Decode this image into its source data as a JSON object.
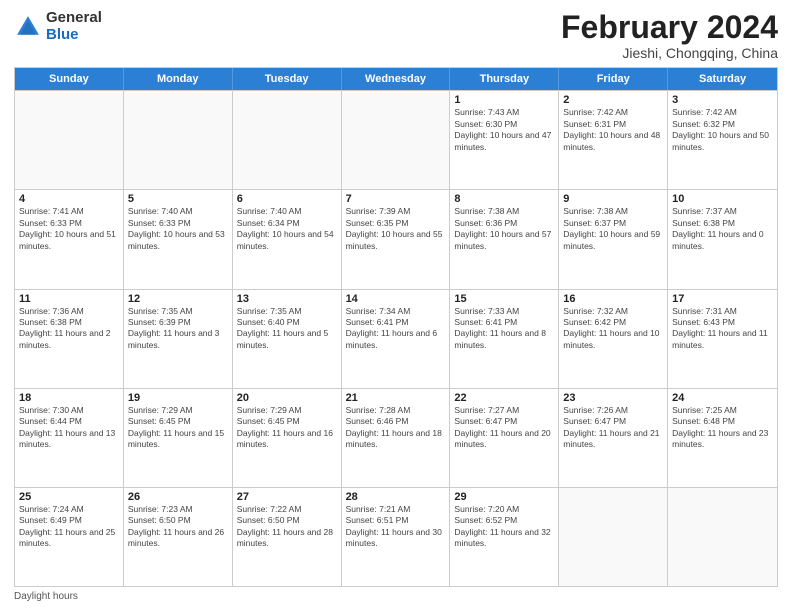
{
  "logo": {
    "general": "General",
    "blue": "Blue"
  },
  "title": {
    "month_year": "February 2024",
    "location": "Jieshi, Chongqing, China"
  },
  "header_days": [
    "Sunday",
    "Monday",
    "Tuesday",
    "Wednesday",
    "Thursday",
    "Friday",
    "Saturday"
  ],
  "weeks": [
    [
      {
        "day": "",
        "info": ""
      },
      {
        "day": "",
        "info": ""
      },
      {
        "day": "",
        "info": ""
      },
      {
        "day": "",
        "info": ""
      },
      {
        "day": "1",
        "info": "Sunrise: 7:43 AM\nSunset: 6:30 PM\nDaylight: 10 hours and 47 minutes."
      },
      {
        "day": "2",
        "info": "Sunrise: 7:42 AM\nSunset: 6:31 PM\nDaylight: 10 hours and 48 minutes."
      },
      {
        "day": "3",
        "info": "Sunrise: 7:42 AM\nSunset: 6:32 PM\nDaylight: 10 hours and 50 minutes."
      }
    ],
    [
      {
        "day": "4",
        "info": "Sunrise: 7:41 AM\nSunset: 6:33 PM\nDaylight: 10 hours and 51 minutes."
      },
      {
        "day": "5",
        "info": "Sunrise: 7:40 AM\nSunset: 6:33 PM\nDaylight: 10 hours and 53 minutes."
      },
      {
        "day": "6",
        "info": "Sunrise: 7:40 AM\nSunset: 6:34 PM\nDaylight: 10 hours and 54 minutes."
      },
      {
        "day": "7",
        "info": "Sunrise: 7:39 AM\nSunset: 6:35 PM\nDaylight: 10 hours and 55 minutes."
      },
      {
        "day": "8",
        "info": "Sunrise: 7:38 AM\nSunset: 6:36 PM\nDaylight: 10 hours and 57 minutes."
      },
      {
        "day": "9",
        "info": "Sunrise: 7:38 AM\nSunset: 6:37 PM\nDaylight: 10 hours and 59 minutes."
      },
      {
        "day": "10",
        "info": "Sunrise: 7:37 AM\nSunset: 6:38 PM\nDaylight: 11 hours and 0 minutes."
      }
    ],
    [
      {
        "day": "11",
        "info": "Sunrise: 7:36 AM\nSunset: 6:38 PM\nDaylight: 11 hours and 2 minutes."
      },
      {
        "day": "12",
        "info": "Sunrise: 7:35 AM\nSunset: 6:39 PM\nDaylight: 11 hours and 3 minutes."
      },
      {
        "day": "13",
        "info": "Sunrise: 7:35 AM\nSunset: 6:40 PM\nDaylight: 11 hours and 5 minutes."
      },
      {
        "day": "14",
        "info": "Sunrise: 7:34 AM\nSunset: 6:41 PM\nDaylight: 11 hours and 6 minutes."
      },
      {
        "day": "15",
        "info": "Sunrise: 7:33 AM\nSunset: 6:41 PM\nDaylight: 11 hours and 8 minutes."
      },
      {
        "day": "16",
        "info": "Sunrise: 7:32 AM\nSunset: 6:42 PM\nDaylight: 11 hours and 10 minutes."
      },
      {
        "day": "17",
        "info": "Sunrise: 7:31 AM\nSunset: 6:43 PM\nDaylight: 11 hours and 11 minutes."
      }
    ],
    [
      {
        "day": "18",
        "info": "Sunrise: 7:30 AM\nSunset: 6:44 PM\nDaylight: 11 hours and 13 minutes."
      },
      {
        "day": "19",
        "info": "Sunrise: 7:29 AM\nSunset: 6:45 PM\nDaylight: 11 hours and 15 minutes."
      },
      {
        "day": "20",
        "info": "Sunrise: 7:29 AM\nSunset: 6:45 PM\nDaylight: 11 hours and 16 minutes."
      },
      {
        "day": "21",
        "info": "Sunrise: 7:28 AM\nSunset: 6:46 PM\nDaylight: 11 hours and 18 minutes."
      },
      {
        "day": "22",
        "info": "Sunrise: 7:27 AM\nSunset: 6:47 PM\nDaylight: 11 hours and 20 minutes."
      },
      {
        "day": "23",
        "info": "Sunrise: 7:26 AM\nSunset: 6:47 PM\nDaylight: 11 hours and 21 minutes."
      },
      {
        "day": "24",
        "info": "Sunrise: 7:25 AM\nSunset: 6:48 PM\nDaylight: 11 hours and 23 minutes."
      }
    ],
    [
      {
        "day": "25",
        "info": "Sunrise: 7:24 AM\nSunset: 6:49 PM\nDaylight: 11 hours and 25 minutes."
      },
      {
        "day": "26",
        "info": "Sunrise: 7:23 AM\nSunset: 6:50 PM\nDaylight: 11 hours and 26 minutes."
      },
      {
        "day": "27",
        "info": "Sunrise: 7:22 AM\nSunset: 6:50 PM\nDaylight: 11 hours and 28 minutes."
      },
      {
        "day": "28",
        "info": "Sunrise: 7:21 AM\nSunset: 6:51 PM\nDaylight: 11 hours and 30 minutes."
      },
      {
        "day": "29",
        "info": "Sunrise: 7:20 AM\nSunset: 6:52 PM\nDaylight: 11 hours and 32 minutes."
      },
      {
        "day": "",
        "info": ""
      },
      {
        "day": "",
        "info": ""
      }
    ]
  ],
  "footer": {
    "daylight_label": "Daylight hours"
  }
}
